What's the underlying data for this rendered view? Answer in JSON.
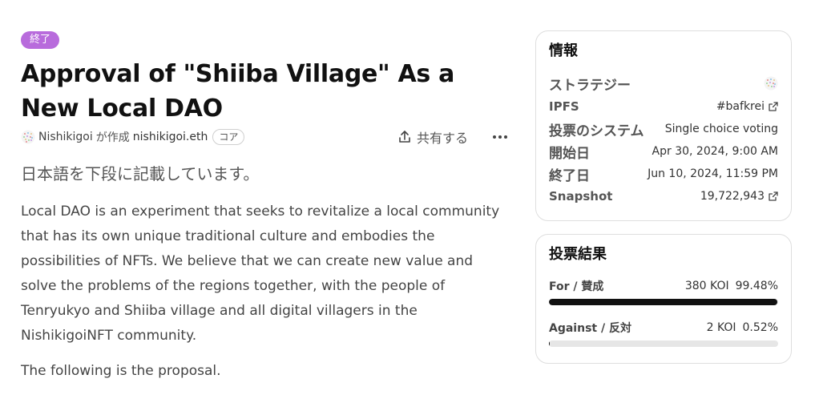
{
  "proposal": {
    "status_badge": "終了",
    "title": "Approval of \"Shiiba Village\" As a New Local DAO",
    "author_name": "Nishikigoi",
    "created_by_text": "が作成",
    "ens_name": "nishikigoi.eth",
    "core_tag": "コア",
    "share_label": "共有する",
    "more_icon": "more-dots-icon",
    "japanese_note": "日本語を下段に記載しています。",
    "body": "Local DAO is an experiment that seeks to revitalize a local community that has its own unique traditional culture and embodies the possibilities of NFTs. We believe that we can create new value and solve the problems of the regions together, with the people of Tenryukyo and Shiiba village and all digital villagers in the NishikigoiNFT community.",
    "following": "The following is the proposal."
  },
  "info": {
    "title": "情報",
    "rows": [
      {
        "label": "ストラテジー",
        "value": "",
        "icon": "strategy-avatar-icon"
      },
      {
        "label": "IPFS",
        "value": "#bafkrei",
        "icon": "external-link-icon"
      },
      {
        "label": "投票のシステム",
        "value": "Single choice voting"
      },
      {
        "label": "開始日",
        "value": "Apr 30, 2024, 9:00 AM"
      },
      {
        "label": "終了日",
        "value": "Jun 10, 2024, 11:59 PM"
      },
      {
        "label": "Snapshot",
        "value": "19,722,943",
        "icon": "external-link-icon"
      }
    ]
  },
  "results": {
    "title": "投票結果",
    "choices": [
      {
        "label": "For / 賛成",
        "amount": "380 KOI",
        "percent": "99.48%",
        "fraction": 0.9948
      },
      {
        "label": "Against / 反対",
        "amount": "2 KOI",
        "percent": "0.52%",
        "fraction": 0.0052
      }
    ]
  },
  "colors": {
    "badge": "#b86bdc",
    "bar_fill": "#111111",
    "bar_track": "#e6e6e6",
    "border": "#dedede"
  }
}
